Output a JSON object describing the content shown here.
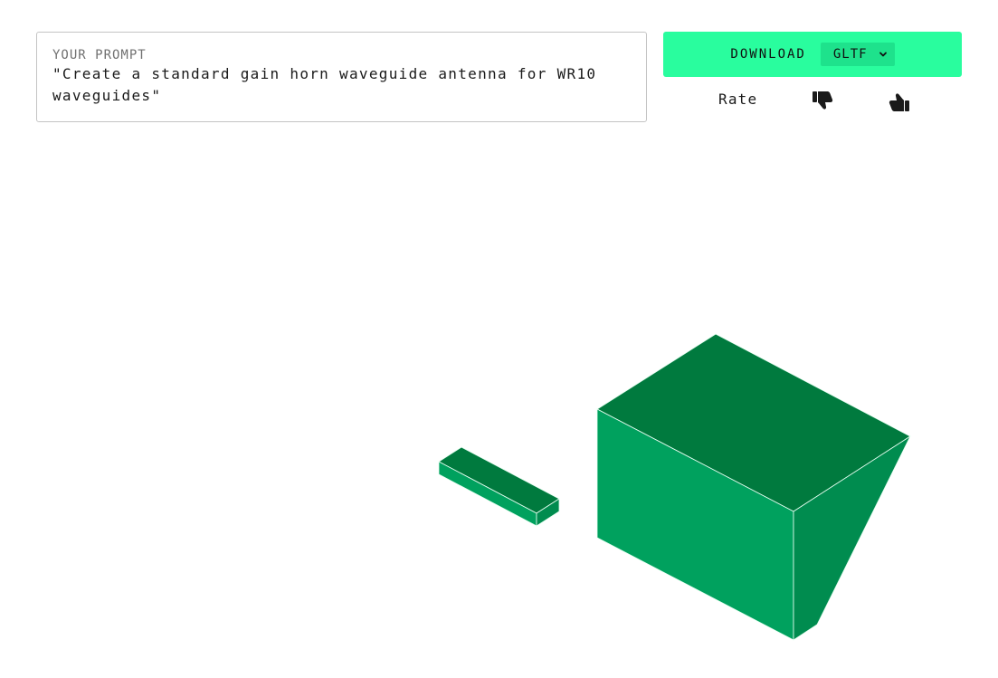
{
  "prompt": {
    "label": "YOUR PROMPT",
    "text": "\"Create a standard gain horn waveguide antenna for WR10 waveguides\""
  },
  "download": {
    "label": "DOWNLOAD",
    "format": "GLTF"
  },
  "rating": {
    "label": "Rate"
  },
  "icons": {
    "thumbs_down": "thumbs-down-icon",
    "thumbs_up": "thumbs-up-icon",
    "chevron": "chevron-down-icon"
  },
  "colors": {
    "accent": "#29fd9e",
    "select_bg": "#1ee28c",
    "model_top": "#007a3e",
    "model_front": "#00a15e",
    "model_side": "#008c4f"
  }
}
